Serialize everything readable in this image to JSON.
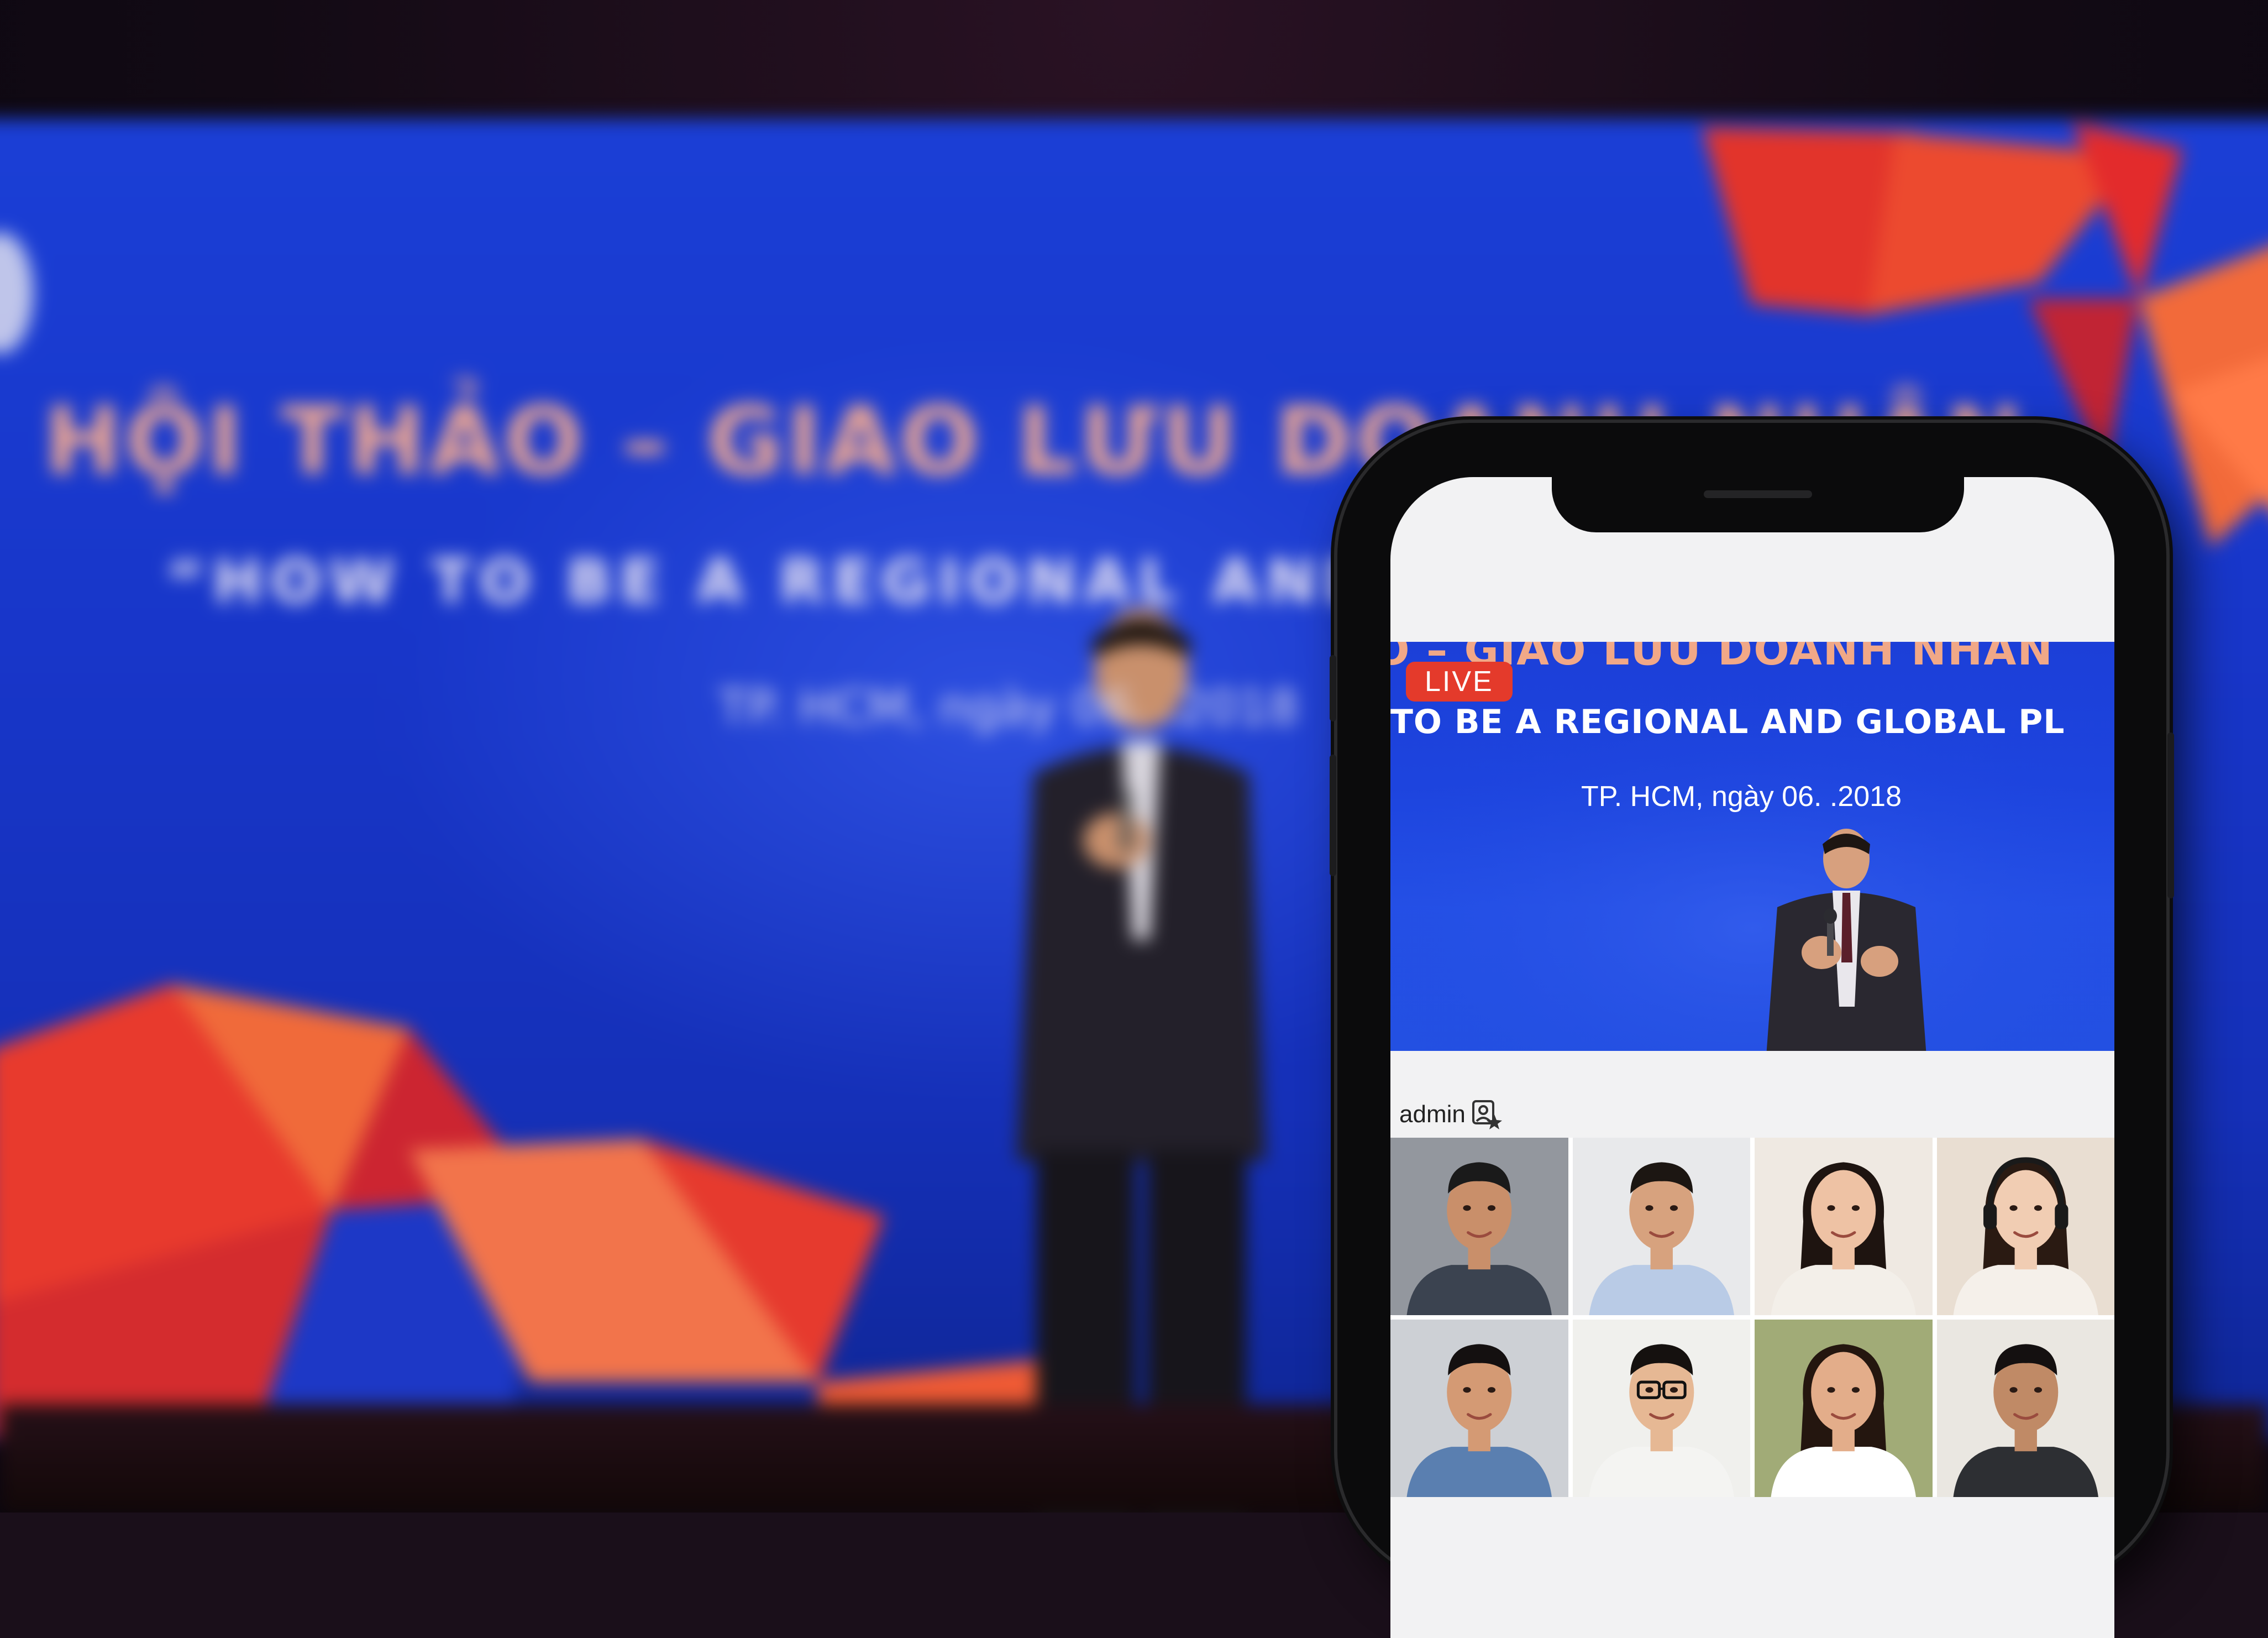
{
  "stage": {
    "title": "HỘI THẢO – GIAO LƯU DOANH NHÂN",
    "subtitle": "“HOW TO BE A REGIONAL AND GL",
    "date": "TP. HCM, ngày 06. .2018"
  },
  "stream": {
    "live_label": "LIVE",
    "title": "O – GIAO LƯU DOANH NHÂN",
    "subtitle": "TO BE A REGIONAL AND GLOBAL PL",
    "date": "TP. HCM, ngày 06. .2018"
  },
  "host": {
    "name": "admin",
    "icon": "admin-badge-icon"
  },
  "participants": [
    {
      "id": "p1",
      "skin": "#c98f6a",
      "hair": "#1a1a1a",
      "shirt": "#3b4350",
      "bg": "#8a8f96"
    },
    {
      "id": "p2",
      "skin": "#d7a27e",
      "hair": "#1c1612",
      "shirt": "#b9cbe6",
      "bg": "#e6e8ea"
    },
    {
      "id": "p3",
      "skin": "#eec2a4",
      "hair": "#1e1410",
      "shirt": "#f3efe9",
      "bg": "#eee8e0"
    },
    {
      "id": "p4",
      "skin": "#f1cdb3",
      "hair": "#2a1a12",
      "shirt": "#f5f0ea",
      "bg": "#e8dccf"
    },
    {
      "id": "p5",
      "skin": "#d49a74",
      "hair": "#141010",
      "shirt": "#5a7fb0",
      "bg": "#c9cdd2"
    },
    {
      "id": "p6",
      "skin": "#e6b894",
      "hair": "#15110f",
      "shirt": "#f4f4f2",
      "bg": "#efefec"
    },
    {
      "id": "p7",
      "skin": "#e3ad8a",
      "hair": "#24160f",
      "shirt": "#ffffff",
      "bg": "#9aa46c"
    },
    {
      "id": "p8",
      "skin": "#c08a66",
      "hair": "#141010",
      "shirt": "#2d2f33",
      "bg": "#e9e5df"
    }
  ],
  "colors": {
    "live_badge": "#e43a2b",
    "stage_blue": "#1b3fd6",
    "accent_red": "#e0322a",
    "accent_orange": "#f4683e"
  }
}
